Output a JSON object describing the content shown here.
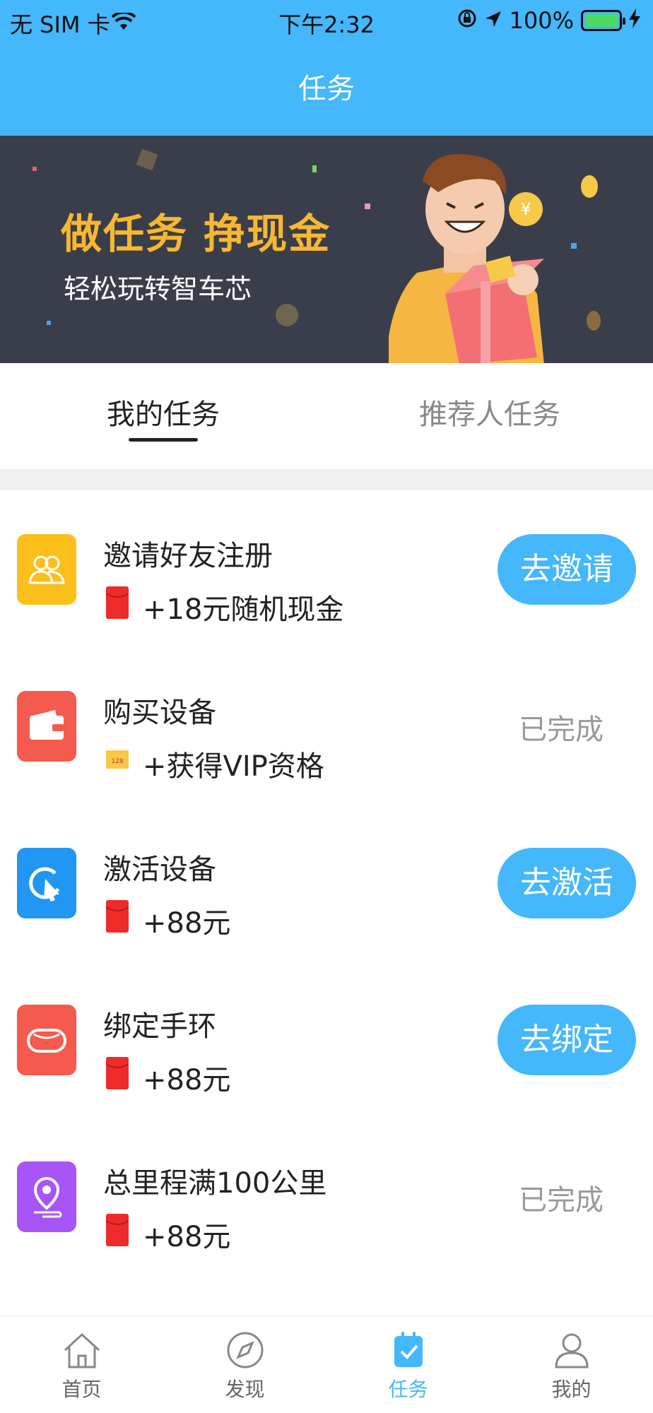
{
  "status_bar": {
    "carrier": "无 SIM 卡",
    "time": "下午2:32",
    "battery": "100%"
  },
  "nav": {
    "title": "任务"
  },
  "banner": {
    "headline": "做任务 挣现金",
    "subline": "轻松玩转智车芯"
  },
  "tabs": [
    {
      "label": "我的任务",
      "active": true
    },
    {
      "label": "推荐人任务",
      "active": false
    }
  ],
  "tasks": [
    {
      "title": "邀请好友注册",
      "reward": "+18元随机现金",
      "action": "去邀请",
      "reward_icon": "red-envelope-icon",
      "icon": "friends-icon",
      "icon_color": "#fdbf1c"
    },
    {
      "title": "购买设备",
      "reward": "+获得VIP资格",
      "status": "已完成",
      "reward_icon": "vip-ticket-icon",
      "icon": "wallet-icon",
      "icon_color": "#f55a4e"
    },
    {
      "title": "激活设备",
      "reward": "+88元",
      "action": "去激活",
      "reward_icon": "red-envelope-icon",
      "icon": "cursor-click-icon",
      "icon_color": "#2196f3"
    },
    {
      "title": "绑定手环",
      "reward": "+88元",
      "action": "去绑定",
      "reward_icon": "red-envelope-icon",
      "icon": "wristband-icon",
      "icon_color": "#f55a4e"
    },
    {
      "title": "总里程满100公里",
      "reward": "+88元",
      "status": "已完成",
      "reward_icon": "red-envelope-icon",
      "icon": "location-pin-icon",
      "icon_color": "#a855f7"
    }
  ],
  "tab_bar": [
    {
      "label": "首页",
      "icon": "home-icon",
      "active": false
    },
    {
      "label": "发现",
      "icon": "compass-icon",
      "active": false
    },
    {
      "label": "任务",
      "icon": "task-calendar-icon",
      "active": true
    },
    {
      "label": "我的",
      "icon": "user-icon",
      "active": false
    }
  ],
  "colors": {
    "accent": "#45b7fb",
    "banner_bg": "#3a3e4a",
    "headline": "#f7b731",
    "done_text": "#999999"
  },
  "ticket_text": "128"
}
